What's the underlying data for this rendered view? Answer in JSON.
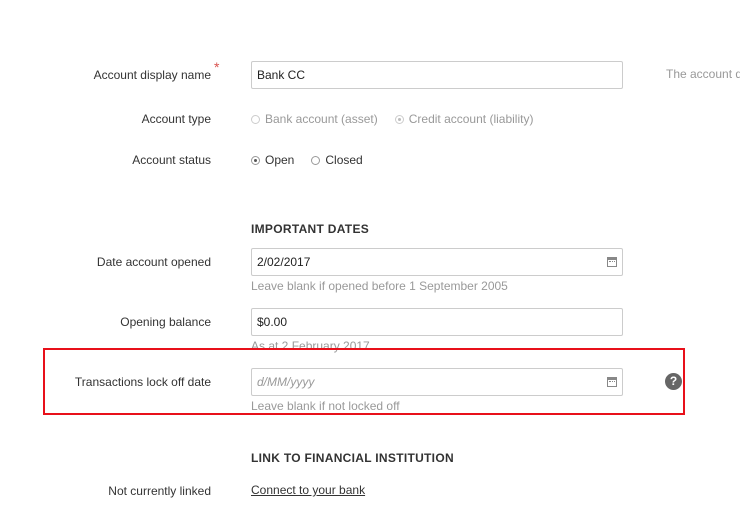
{
  "account_display_name": {
    "label": "Account display name",
    "required_marker": "*",
    "value": "Bank CC",
    "side_note": "The account d"
  },
  "account_type": {
    "label": "Account type",
    "options": [
      {
        "label": "Bank account (asset)",
        "checked": false,
        "disabled": true
      },
      {
        "label": "Credit account (liability)",
        "checked": true,
        "disabled": true
      }
    ]
  },
  "account_status": {
    "label": "Account status",
    "options": [
      {
        "label": "Open",
        "checked": true
      },
      {
        "label": "Closed",
        "checked": false
      }
    ]
  },
  "important_dates": {
    "heading": "IMPORTANT DATES",
    "date_opened": {
      "label": "Date account opened",
      "value": "2/02/2017",
      "hint": "Leave blank if opened before 1 September 2005",
      "icon": "calendar-icon"
    },
    "opening_balance": {
      "label": "Opening balance",
      "value": "$0.00",
      "hint": "As at 2 February 2017"
    },
    "lock_off_date": {
      "label": "Transactions lock off date",
      "placeholder": "d/MM/yyyy",
      "hint": "Leave blank if not locked off",
      "icon": "calendar-icon",
      "help_icon": "?"
    }
  },
  "financial_institution": {
    "heading": "LINK TO FINANCIAL INSTITUTION",
    "status_label": "Not currently linked",
    "connect_link": "Connect to your bank"
  },
  "colors": {
    "highlight": "#e8101a",
    "required": "#d9534f",
    "hint": "#999999"
  }
}
